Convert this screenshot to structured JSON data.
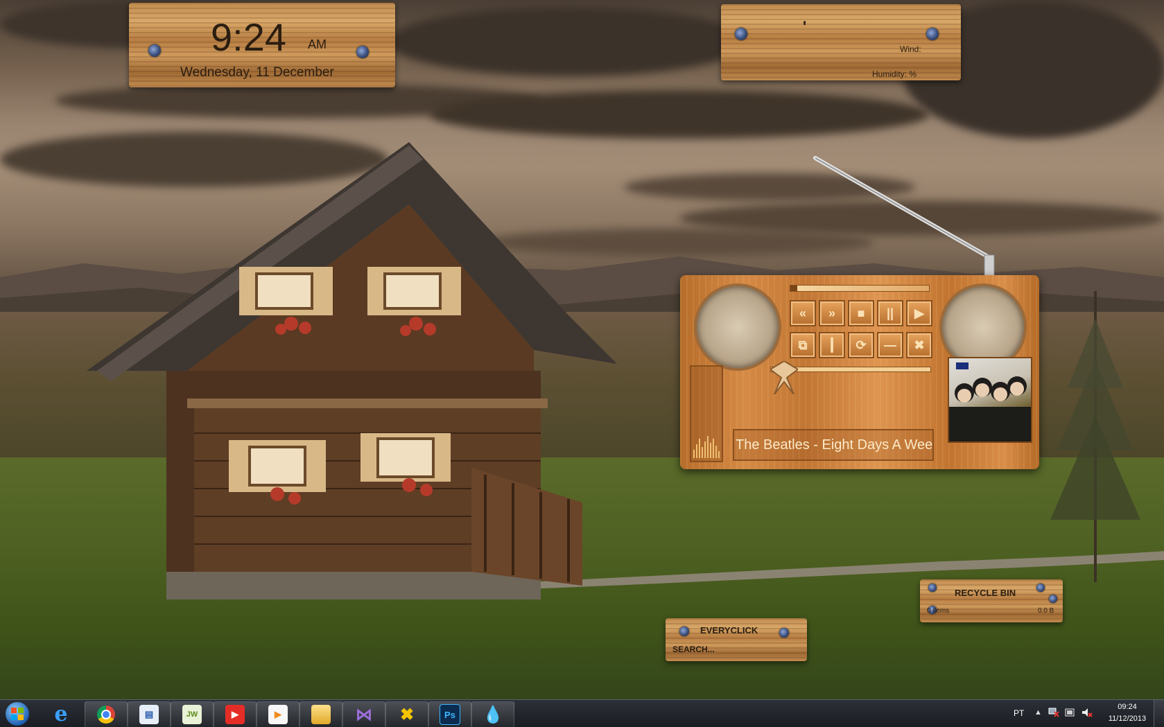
{
  "clock_widget": {
    "time": "9:24",
    "ampm": "AM",
    "date": "Wednesday, 11 December"
  },
  "weather_widget": {
    "temp_mark": "'",
    "wind_label": "Wind:",
    "humidity_label": "Humidity: %"
  },
  "media_player": {
    "track_title": "The Beatles - Eight Days A Week",
    "controls": {
      "prev": "«",
      "next": "»",
      "stop": "■",
      "pause": "||",
      "play": "▶",
      "mini": "⧉",
      "eq": "┃",
      "repeat": "⟳",
      "minimize": "—",
      "close": "✖"
    },
    "progress": 0.05,
    "volume": 0.55
  },
  "recycle_bin_widget": {
    "title": "RECYCLE BIN",
    "items": "0 items",
    "size": "0.0 B"
  },
  "search_widget": {
    "title": "EVERYCLICK",
    "placeholder": "SEARCH..."
  },
  "taskbar": {
    "apps": [
      {
        "name": "internet-explorer"
      },
      {
        "name": "chrome"
      },
      {
        "name": "text-editor"
      },
      {
        "name": "jw-player"
      },
      {
        "name": "youtube"
      },
      {
        "name": "media-player"
      },
      {
        "name": "file-explorer"
      },
      {
        "name": "visual-studio"
      },
      {
        "name": "tools"
      },
      {
        "name": "photoshop",
        "label": "Ps"
      },
      {
        "name": "droplet"
      }
    ],
    "language": "PT",
    "clock_time": "09:24",
    "clock_date": "11/12/2013"
  }
}
